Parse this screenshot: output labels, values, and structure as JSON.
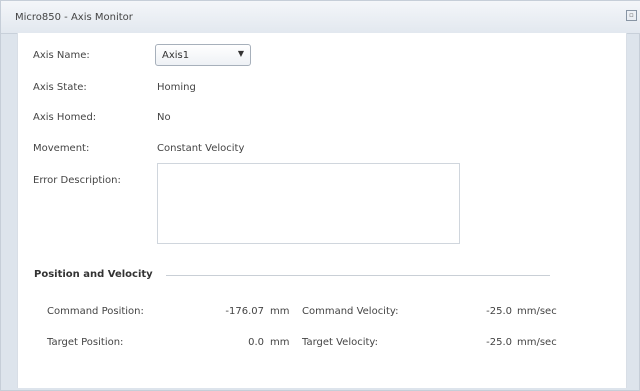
{
  "window": {
    "title": "Micro850 - Axis Monitor",
    "corner_icon": "▫"
  },
  "fields": {
    "axis_name_label": "Axis Name:",
    "axis_name_value": "Axis1",
    "axis_state_label": "Axis State:",
    "axis_state_value": "Homing",
    "axis_homed_label": "Axis Homed:",
    "axis_homed_value": "No",
    "movement_label": "Movement:",
    "movement_value": "Constant Velocity",
    "error_description_label": "Error Description:",
    "error_description_value": ""
  },
  "position_velocity": {
    "section_title": "Position and Velocity",
    "command_position_label": "Command Position:",
    "command_position_value": "-176.07",
    "command_position_unit": "mm",
    "target_position_label": "Target Position:",
    "target_position_value": "0.0",
    "target_position_unit": "mm",
    "command_velocity_label": "Command Velocity:",
    "command_velocity_value": "-25.0",
    "command_velocity_unit": "mm/sec",
    "target_velocity_label": "Target Velocity:",
    "target_velocity_value": "-25.0",
    "target_velocity_unit": "mm/sec"
  },
  "icons": {
    "dropdown": "chevron-down-icon",
    "restore": "window-restore-icon"
  }
}
